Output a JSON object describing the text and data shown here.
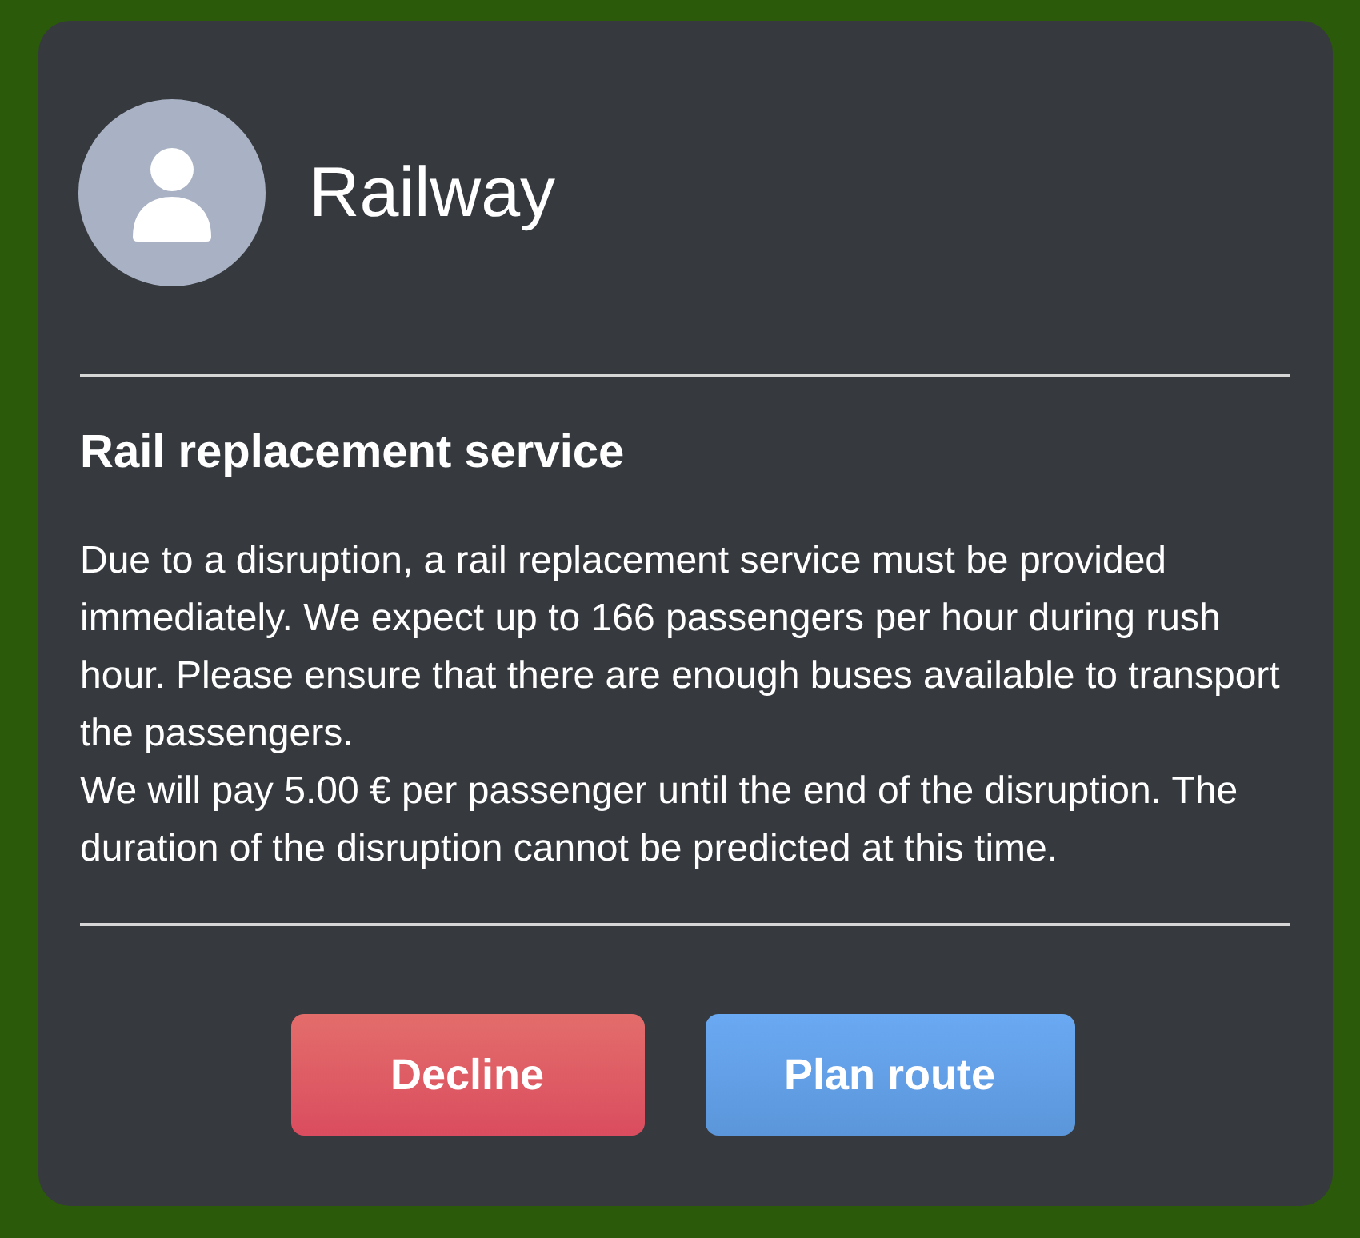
{
  "sender": {
    "name": "Railway"
  },
  "message": {
    "title": "Rail replacement service",
    "paragraphs": [
      "Due to a disruption, a rail replacement service must be provided immediately. We expect up to 166 passengers per hour during rush hour. Please ensure that there are enough buses available to transport the passengers.",
      "We will pay 5.00 € per passenger until the end of the disruption. The duration of the disruption cannot be predicted at this time."
    ]
  },
  "buttons": [
    {
      "label": "Decline",
      "kind": "decline"
    },
    {
      "label": "Plan route",
      "kind": "accept"
    }
  ]
}
